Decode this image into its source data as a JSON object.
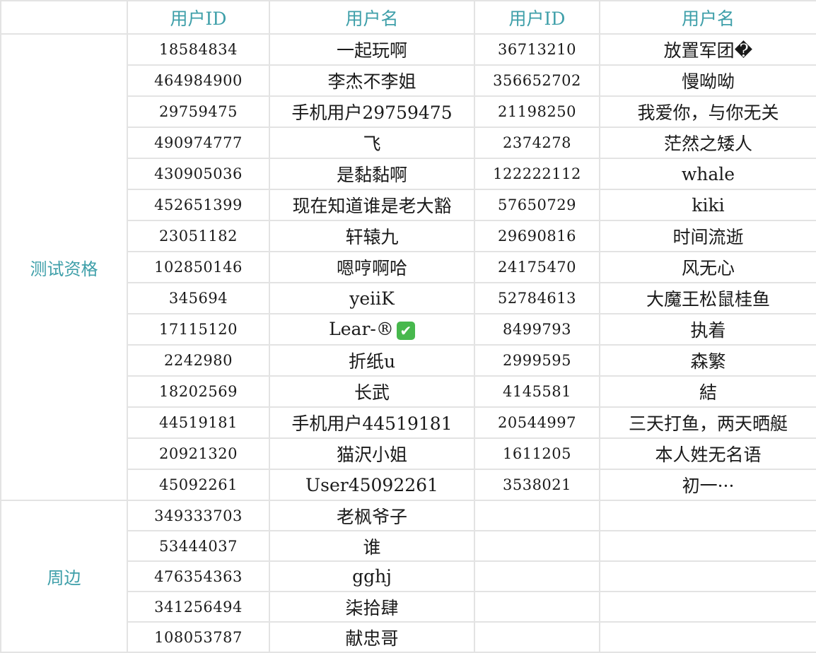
{
  "header": {
    "user_id": "用户ID",
    "user_name": "用户名"
  },
  "groups": [
    {
      "label": "测试资格",
      "rows": [
        {
          "id1": "18584834",
          "name1": "一起玩啊",
          "id2": "36713210",
          "name2": "放置军团�"
        },
        {
          "id1": "464984900",
          "name1": "李杰不李姐",
          "id2": "356652702",
          "name2": "慢呦呦"
        },
        {
          "id1": "29759475",
          "name1": "手机用户29759475",
          "id2": "21198250",
          "name2": "我爱你，与你无关"
        },
        {
          "id1": "490974777",
          "name1": "飞",
          "id2": "2374278",
          "name2": "茫然之矮人"
        },
        {
          "id1": "430905036",
          "name1": "是黏黏啊",
          "id2": "122222112",
          "name2": "whale"
        },
        {
          "id1": "452651399",
          "name1": "现在知道谁是老大豁",
          "id2": "57650729",
          "name2": "kiki"
        },
        {
          "id1": "23051182",
          "name1": "轩辕九",
          "id2": "29690816",
          "name2": "时间流逝"
        },
        {
          "id1": "102850146",
          "name1": "嗯哼啊哈",
          "id2": "24175470",
          "name2": "风无心"
        },
        {
          "id1": "345694",
          "name1": "yeiiK",
          "id2": "52784613",
          "name2": "大魔王松鼠桂鱼"
        },
        {
          "id1": "17115120",
          "name1": "Lear-®",
          "name1_emoji": "check-mark-button",
          "id2": "8499793",
          "name2": "执着"
        },
        {
          "id1": "2242980",
          "name1": "折纸u",
          "id2": "2999595",
          "name2": "森繁"
        },
        {
          "id1": "18202569",
          "name1": "长武",
          "id2": "4145581",
          "name2": "結"
        },
        {
          "id1": "44519181",
          "name1": "手机用户44519181",
          "id2": "20544997",
          "name2": "三天打鱼，两天晒艇"
        },
        {
          "id1": "20921320",
          "name1": "猫沢小姐",
          "id2": "1611205",
          "name2": "本人姓无名语"
        },
        {
          "id1": "45092261",
          "name1": "User45092261",
          "id2": "3538021",
          "name2": "初一···"
        }
      ]
    },
    {
      "label": "周边",
      "rows": [
        {
          "id1": "349333703",
          "name1": "老枫爷子",
          "id2": "",
          "name2": ""
        },
        {
          "id1": "53444037",
          "name1": "谁",
          "id2": "",
          "name2": ""
        },
        {
          "id1": "476354363",
          "name1": "gghj",
          "id2": "",
          "name2": ""
        },
        {
          "id1": "341256494",
          "name1": "柒拾肆",
          "id2": "",
          "name2": ""
        },
        {
          "id1": "108053787",
          "name1": "献忠哥",
          "id2": "",
          "name2": ""
        }
      ]
    }
  ],
  "colors": {
    "header_text": "#3e9fa9",
    "grid_line": "#e3e3e3",
    "emoji_check": "#47b84d"
  }
}
